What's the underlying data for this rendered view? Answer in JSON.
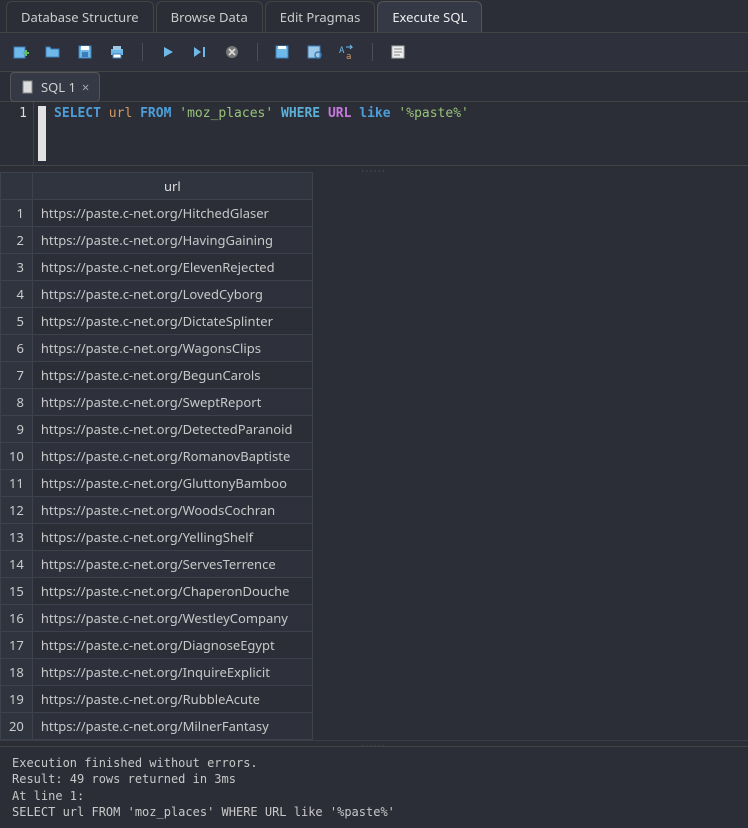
{
  "topTabs": {
    "dbStructure": "Database Structure",
    "browseData": "Browse Data",
    "editPragmas": "Edit Pragmas",
    "executeSql": "Execute SQL"
  },
  "fileTab": {
    "name": "SQL 1"
  },
  "gutterLine": "1",
  "sql": {
    "select": "SELECT",
    "col": "url",
    "from": "FROM",
    "table": "'moz_places'",
    "where": "WHERE",
    "urlKw": "URL",
    "like": "like",
    "pattern": "'%paste%'"
  },
  "columns": {
    "url": "url"
  },
  "rows": [
    "https://paste.c-net.org/HitchedGlaser",
    "https://paste.c-net.org/HavingGaining",
    "https://paste.c-net.org/ElevenRejected",
    "https://paste.c-net.org/LovedCyborg",
    "https://paste.c-net.org/DictateSplinter",
    "https://paste.c-net.org/WagonsClips",
    "https://paste.c-net.org/BegunCarols",
    "https://paste.c-net.org/SweptReport",
    "https://paste.c-net.org/DetectedParanoid",
    "https://paste.c-net.org/RomanovBaptiste",
    "https://paste.c-net.org/GluttonyBamboo",
    "https://paste.c-net.org/WoodsCochran",
    "https://paste.c-net.org/YellingShelf",
    "https://paste.c-net.org/ServesTerrence",
    "https://paste.c-net.org/ChaperonDouche",
    "https://paste.c-net.org/WestleyCompany",
    "https://paste.c-net.org/DiagnoseEgypt",
    "https://paste.c-net.org/InquireExplicit",
    "https://paste.c-net.org/RubbleAcute",
    "https://paste.c-net.org/MilnerFantasy"
  ],
  "status": {
    "l1": "Execution finished without errors.",
    "l2": "Result: 49 rows returned in 3ms",
    "l3": "At line 1:",
    "l4": "SELECT url FROM 'moz_places' WHERE URL like '%paste%'"
  }
}
